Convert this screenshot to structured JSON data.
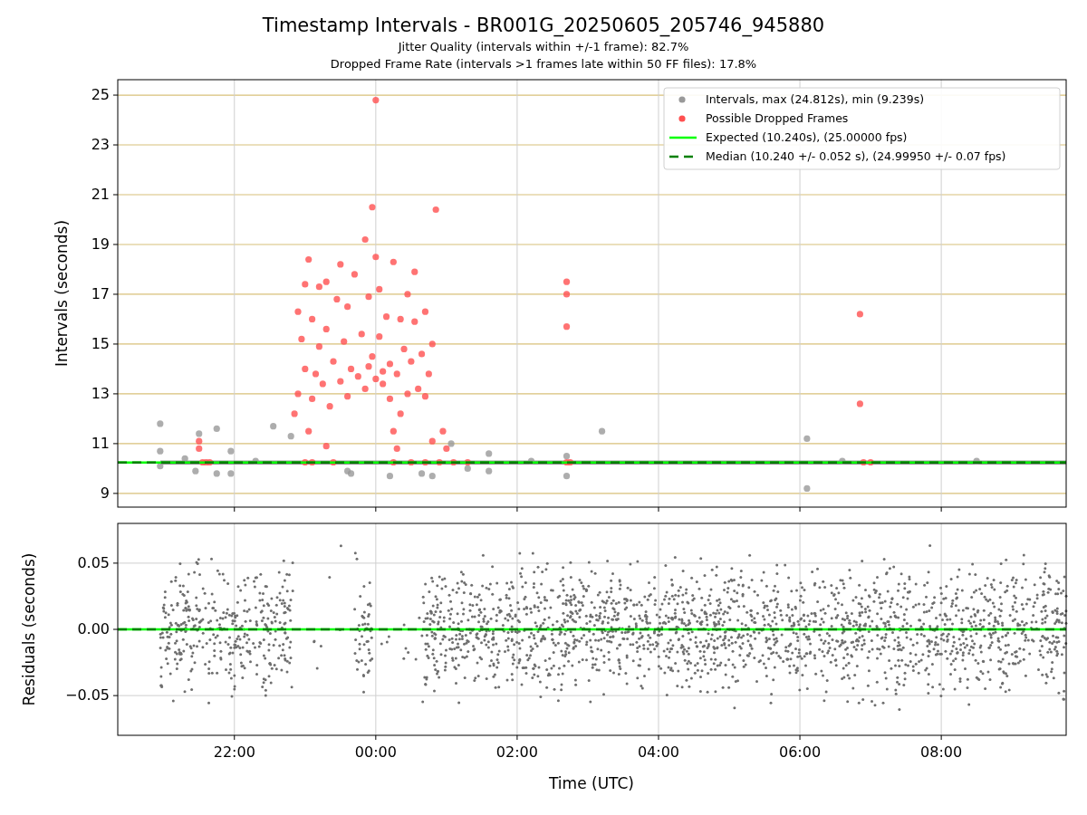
{
  "figure": {
    "title": "Timestamp Intervals - BR001G_20250605_205746_945880",
    "subtitles": [
      "Jitter Quality (intervals within +/-1 frame): 82.7%",
      "Dropped Frame Rate (intervals >1 frames late within 50 FF files): 17.8%"
    ]
  },
  "intervals_plot": {
    "chart_data": {
      "type": "scatter",
      "ylabel": "Intervals (seconds)",
      "grid": true,
      "xlim": [
        "2025-06-05T20:21",
        "2025-06-06T09:46"
      ],
      "ylim": [
        8.45,
        25.62
      ],
      "yticks": [
        {
          "value": 9,
          "label": "9"
        },
        {
          "value": 11,
          "label": "11"
        },
        {
          "value": 13,
          "label": "13"
        },
        {
          "value": 15,
          "label": "15"
        },
        {
          "value": 17,
          "label": "17"
        },
        {
          "value": 19,
          "label": "19"
        },
        {
          "value": 21,
          "label": "21"
        },
        {
          "value": 23,
          "label": "23"
        },
        {
          "value": 25,
          "label": "25"
        }
      ],
      "series": [
        {
          "name": "Intervals, max (24.812s), min (9.239s)",
          "color": "#999999",
          "x": [
            "2025-06-05T20:57",
            "2025-06-05T20:57",
            "2025-06-05T20:57",
            "2025-06-05T21:30",
            "2025-06-05T21:27",
            "2025-06-05T21:45",
            "2025-06-05T21:45",
            "2025-06-05T21:57",
            "2025-06-05T21:57",
            "2025-06-05T22:33",
            "2025-06-05T22:48",
            "2025-06-05T23:36",
            "2025-06-05T23:39",
            "2025-06-06T00:12",
            "2025-06-06T00:39",
            "2025-06-06T00:48",
            "2025-06-06T01:04",
            "2025-06-06T01:18",
            "2025-06-06T01:36",
            "2025-06-06T01:36",
            "2025-06-06T02:12",
            "2025-06-06T02:42",
            "2025-06-06T02:42",
            "2025-06-06T03:12",
            "2025-06-06T06:06",
            "2025-06-06T06:06",
            "2025-06-06T06:36",
            "2025-06-06T08:30",
            "2025-06-05T21:18",
            "2025-06-05T22:18"
          ],
          "values": [
            11.8,
            10.7,
            10.1,
            11.4,
            9.9,
            11.6,
            9.8,
            10.7,
            9.8,
            11.7,
            11.3,
            9.9,
            9.8,
            9.7,
            9.8,
            9.7,
            11.0,
            10.0,
            10.6,
            9.9,
            10.3,
            10.5,
            9.7,
            11.5,
            11.2,
            9.2,
            10.3,
            10.3,
            10.4,
            10.3
          ]
        },
        {
          "name": "Possible Dropped Frames",
          "color": "#ff5050",
          "x": [
            "2025-06-05T21:30",
            "2025-06-05T21:30",
            "2025-06-05T21:33",
            "2025-06-05T21:36",
            "2025-06-05T21:39",
            "2025-06-05T22:51",
            "2025-06-05T22:54",
            "2025-06-05T22:54",
            "2025-06-05T22:57",
            "2025-06-05T23:00",
            "2025-06-05T23:00",
            "2025-06-05T23:03",
            "2025-06-05T23:03",
            "2025-06-05T23:06",
            "2025-06-05T23:06",
            "2025-06-05T23:09",
            "2025-06-05T23:12",
            "2025-06-05T23:12",
            "2025-06-05T23:15",
            "2025-06-05T23:18",
            "2025-06-05T23:18",
            "2025-06-05T23:21",
            "2025-06-05T23:24",
            "2025-06-05T23:27",
            "2025-06-05T23:30",
            "2025-06-05T23:30",
            "2025-06-05T23:33",
            "2025-06-05T23:36",
            "2025-06-05T23:36",
            "2025-06-05T23:39",
            "2025-06-05T23:42",
            "2025-06-05T23:45",
            "2025-06-05T23:48",
            "2025-06-05T23:51",
            "2025-06-05T23:51",
            "2025-06-05T23:54",
            "2025-06-05T23:57",
            "2025-06-06T00:00",
            "2025-06-06T00:00",
            "2025-06-06T00:03",
            "2025-06-06T00:03",
            "2025-06-06T00:06",
            "2025-06-06T00:09",
            "2025-06-06T00:12",
            "2025-06-06T00:12",
            "2025-06-06T00:15",
            "2025-06-06T00:15",
            "2025-06-06T00:18",
            "2025-06-06T00:21",
            "2025-06-06T00:21",
            "2025-06-06T00:24",
            "2025-06-06T00:27",
            "2025-06-06T00:27",
            "2025-06-06T00:30",
            "2025-06-06T00:33",
            "2025-06-06T00:33",
            "2025-06-06T00:36",
            "2025-06-06T00:39",
            "2025-06-06T00:42",
            "2025-06-06T00:42",
            "2025-06-06T00:45",
            "2025-06-06T00:48",
            "2025-06-06T00:48",
            "2025-06-06T00:51",
            "2025-06-06T00:57",
            "2025-06-06T01:00",
            "2025-06-05T23:06",
            "2025-06-05T23:24",
            "2025-06-06T00:15",
            "2025-06-06T00:30",
            "2025-06-06T00:42",
            "2025-06-06T00:54",
            "2025-06-06T01:06",
            "2025-06-06T01:18",
            "2025-06-05T23:00",
            "2025-06-06T00:00",
            "2025-06-05T23:57",
            "2025-06-06T02:42",
            "2025-06-06T02:42",
            "2025-06-06T02:42",
            "2025-06-06T02:42",
            "2025-06-06T02:45",
            "2025-06-06T06:51",
            "2025-06-06T06:51",
            "2025-06-06T06:54",
            "2025-06-06T07:00",
            "2025-06-05T23:18",
            "2025-06-05T23:54",
            "2025-06-06T00:06",
            "2025-06-06T00:18"
          ],
          "values": [
            10.8,
            11.1,
            10.25,
            10.25,
            10.25,
            12.2,
            13.0,
            16.3,
            15.2,
            17.4,
            14.0,
            18.4,
            11.5,
            12.8,
            16.0,
            13.8,
            17.3,
            14.9,
            13.4,
            15.6,
            17.5,
            12.5,
            14.3,
            16.8,
            18.2,
            13.5,
            15.1,
            16.5,
            12.9,
            14.0,
            17.8,
            13.7,
            15.4,
            19.2,
            13.2,
            16.9,
            14.5,
            18.5,
            13.6,
            15.3,
            17.2,
            13.9,
            16.1,
            12.8,
            14.2,
            11.5,
            18.3,
            10.8,
            12.2,
            16.0,
            14.8,
            17.0,
            13.0,
            14.3,
            15.9,
            17.9,
            13.2,
            14.6,
            16.3,
            12.9,
            13.8,
            15.0,
            11.1,
            20.4,
            11.5,
            10.8,
            10.25,
            10.25,
            10.25,
            10.25,
            10.25,
            10.25,
            10.25,
            10.25,
            10.25,
            24.8,
            20.5,
            17.5,
            17.0,
            15.7,
            10.25,
            10.25,
            16.2,
            12.6,
            10.25,
            10.25,
            10.9,
            14.1,
            13.4,
            13.8
          ]
        }
      ],
      "legend": true,
      "bands": [
        {
          "axis": "y",
          "from": 10.16,
          "to": 10.32,
          "color": "#8a8a8a"
        }
      ],
      "ref_lines": [
        {
          "axis": "y",
          "value": 10.24,
          "label": "Expected (10.240s), (25.00000 fps)",
          "color": "#00ff00"
        },
        {
          "axis": "y",
          "value": 10.24,
          "label": "Median (10.240 +/- 0.052 s), (24.99950 +/- 0.07 fps)",
          "color": "#008000"
        }
      ]
    }
  },
  "residuals_plot": {
    "chart_data": {
      "type": "scatter",
      "xlabel": "Time (UTC)",
      "ylabel": "Residuals (seconds)",
      "grid": true,
      "xlim": [
        "2025-06-05T20:21",
        "2025-06-06T09:46"
      ],
      "ylim": [
        -0.08,
        0.08
      ],
      "xticks": [
        {
          "value": "2025-06-05T22:00",
          "label": "22:00"
        },
        {
          "value": "2025-06-06T00:00",
          "label": "00:00"
        },
        {
          "value": "2025-06-06T02:00",
          "label": "02:00"
        },
        {
          "value": "2025-06-06T04:00",
          "label": "04:00"
        },
        {
          "value": "2025-06-06T06:00",
          "label": "06:00"
        },
        {
          "value": "2025-06-06T08:00",
          "label": "08:00"
        }
      ],
      "yticks": [
        {
          "value": 0.05,
          "label": "0.05"
        },
        {
          "value": 0,
          "label": "0.00"
        },
        {
          "value": -0.05,
          "label": "−0.05"
        }
      ],
      "ref_lines": [
        {
          "axis": "y",
          "value": 0,
          "color": "#00ff00"
        },
        {
          "axis": "y",
          "value": 0,
          "color": "#008000"
        }
      ]
    }
  }
}
